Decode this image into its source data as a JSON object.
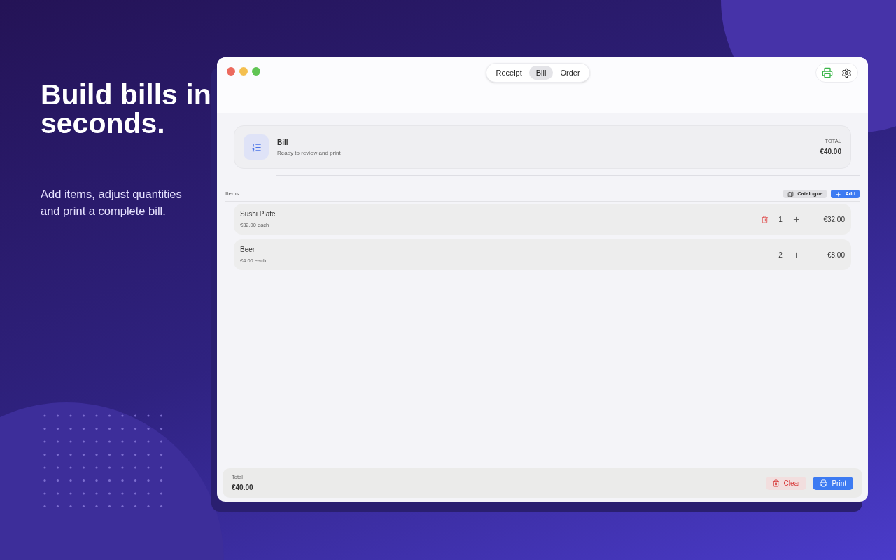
{
  "headline": "Build bills in seconds.",
  "subline": "Add items, adjust quantities and print a complete bill.",
  "window": {
    "tabs": [
      {
        "label": "Receipt",
        "selected": false
      },
      {
        "label": "Bill",
        "selected": true
      },
      {
        "label": "Order",
        "selected": false
      }
    ],
    "header": {
      "title": "Bill",
      "subtitle": "Ready to review and print",
      "total_label": "TOTAL",
      "total": "€40.00"
    },
    "items_label": "Items",
    "catalogue_button": "Catalogue",
    "add_button": "Add",
    "items": [
      {
        "name": "Sushi Plate",
        "unit": "€32.00 each",
        "qty": "1",
        "price": "€32.00",
        "kind": "delete"
      },
      {
        "name": "Beer",
        "unit": "€4.00 each",
        "qty": "2",
        "price": "€8.00",
        "kind": "minus"
      }
    ],
    "footer": {
      "total_label": "Total",
      "total": "€40.00",
      "clear_button": "Clear",
      "print_button": "Print"
    }
  }
}
